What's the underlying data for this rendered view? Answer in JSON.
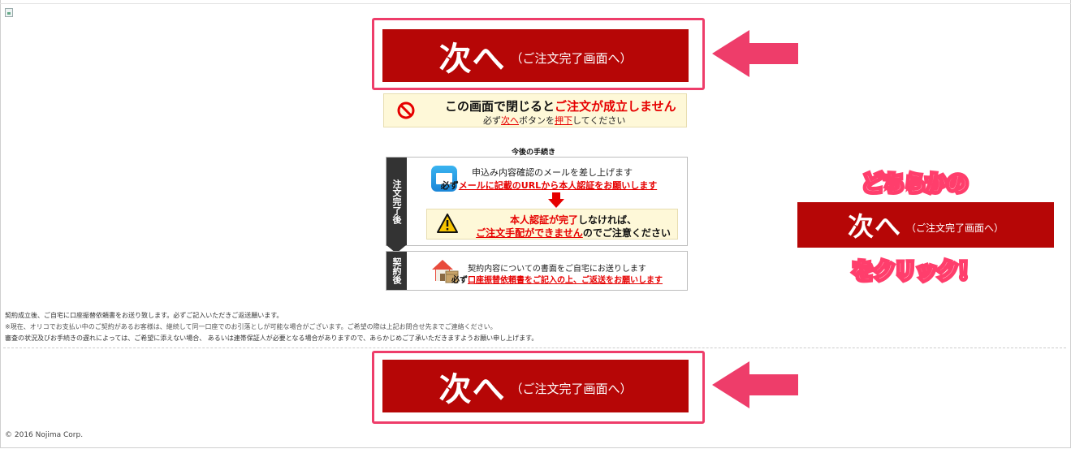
{
  "next_button": {
    "main_label": "次へ",
    "sub_label": "（ご注文完了画面へ）"
  },
  "warning": {
    "line1_prefix": "この画面で閉じると",
    "line1_red": "ご注文が成立しません",
    "line2_a": "必ず",
    "line2_b": "次へ",
    "line2_c": "ボタンを",
    "line2_d": "押下",
    "line2_e": "してください"
  },
  "steps": {
    "title": "今後の手続き",
    "after_order_tab": "注文完了後",
    "mail_line1": "申込み内容確認のメールを差し上げます",
    "mail_line2_a": "必ず",
    "mail_line2_b": "メールに記載のURLから本人認証をお願いします",
    "caution_line1_a": "本人認証が完了",
    "caution_line1_b": "しなければ、",
    "caution_line2_a": "ご注文手配ができません",
    "caution_line2_b": "のでご注意ください",
    "after_contract_tab": "契約後",
    "doc_line1": "契約内容についての書面をご自宅にお送りします",
    "doc_line2_a": "必ず",
    "doc_line2_b": "口座振替依頼書をご記入の上、ご返送をお願いします"
  },
  "notes": {
    "line1": "契約成立後、ご自宅に口座振替依頼書をお送り致します。必ずご記入いただきご返送願います。",
    "line2": "※現在、オリコでお支払い中のご契約があるお客様は、継続して同一口座でのお引落としが可能な場合がございます。ご希望の際は上記お問合せ先までご連絡ください。",
    "line3": "審査の状況及びお手続きの遅れによっては、ご希望に添えない場合、 あるいは連帯保証人が必要となる場合がありますので、あらかじめご了承いただきますようお願い申し上げます。"
  },
  "callout": {
    "line1": "どちらかの",
    "button_main": "次へ",
    "button_sub": "（ご注文完了画面へ）",
    "line3": "をクリック！"
  },
  "footer": {
    "copyright": "© 2016 Nojima Corp."
  },
  "colors": {
    "button_red": "#b60606",
    "annotation_pink": "#ee3d6a",
    "warning_red": "#e60000",
    "warning_bg": "#fef8d8"
  },
  "icons": {
    "prohibited": "prohibited-icon",
    "mail": "mail-icon",
    "down_arrow": "down-arrow-icon",
    "caution": "caution-icon",
    "house": "house-icon",
    "pointer_arrow": "left-arrow-icon"
  }
}
